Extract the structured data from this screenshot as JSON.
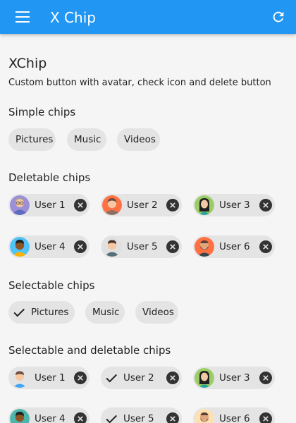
{
  "appbar": {
    "title": "X Chip",
    "menu_icon": "hamburger-menu-icon",
    "action_icon": "refresh-icon"
  },
  "colors": {
    "appbar": "#2196f3",
    "chip": "#e4e4e4",
    "background": "#f5f5f5"
  },
  "page": {
    "title": "XChip",
    "subtitle": "Custom button with avatar, check icon and delete button"
  },
  "sections": {
    "simple": {
      "heading": "Simple chips",
      "chips": [
        "Pictures",
        "Music",
        "Videos"
      ]
    },
    "deletable": {
      "heading": "Deletable chips",
      "chips": [
        "User 1",
        "User 2",
        "User 3",
        "User 4",
        "User 5",
        "User 6"
      ]
    },
    "selectable": {
      "heading": "Selectable chips",
      "chips": [
        {
          "label": "Pictures",
          "selected": true
        },
        {
          "label": "Music",
          "selected": false
        },
        {
          "label": "Videos",
          "selected": false
        }
      ]
    },
    "selectable_deletable": {
      "heading": "Selectable and deletable chips",
      "chips": [
        {
          "label": "User 1",
          "selected": false
        },
        {
          "label": "User 2",
          "selected": true
        },
        {
          "label": "User 3",
          "selected": false
        },
        {
          "label": "User 4",
          "selected": false
        },
        {
          "label": "User 5",
          "selected": true
        },
        {
          "label": "User 6",
          "selected": false
        }
      ]
    }
  }
}
